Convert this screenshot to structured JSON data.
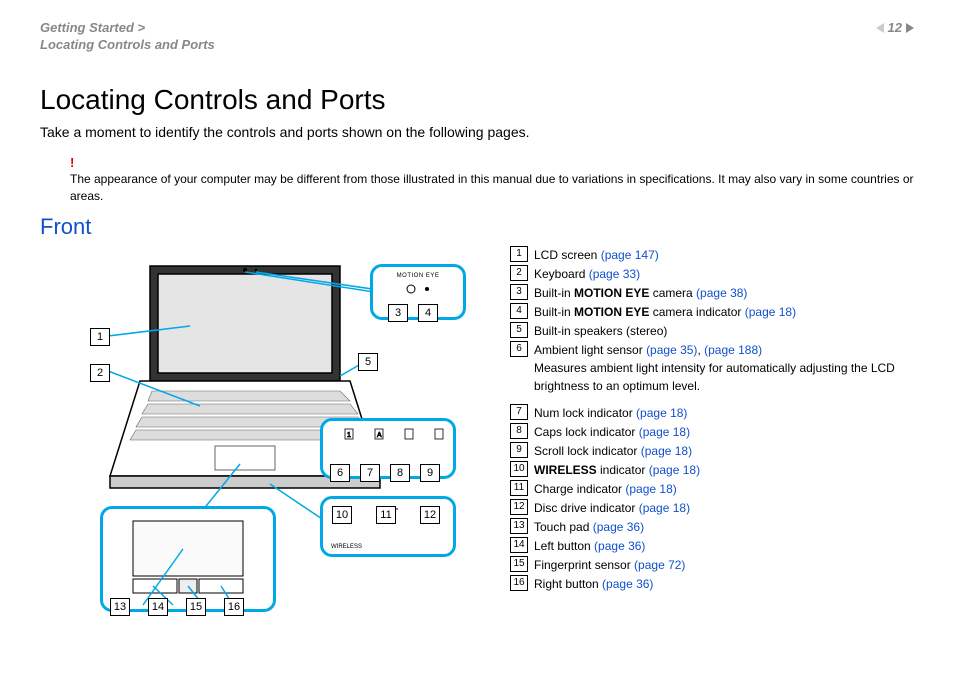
{
  "header": {
    "breadcrumb_line1": "Getting Started >",
    "breadcrumb_line2": "Locating Controls and Ports",
    "page_number": "12"
  },
  "title": "Locating Controls and Ports",
  "intro": "Take a moment to identify the controls and ports shown on the following pages.",
  "note_bang": "!",
  "note_text": "The appearance of your computer may be different from those illustrated in this manual due to variations in specifications. It may also vary in some countries or areas.",
  "section": "Front",
  "inset_labels": {
    "motion_eye": "MOTION EYE",
    "wireless": "WIRELESS"
  },
  "callouts": {
    "c1": "1",
    "c2": "2",
    "c3": "3",
    "c4": "4",
    "c5": "5",
    "c6": "6",
    "c7": "7",
    "c8": "8",
    "c9": "9",
    "c10": "10",
    "c11": "11",
    "c12": "12",
    "c13": "13",
    "c14": "14",
    "c15": "15",
    "c16": "16"
  },
  "legend": [
    {
      "num": "1",
      "pre": "LCD screen ",
      "bold": "",
      "post": "",
      "link": "(page 147)",
      "extra": ""
    },
    {
      "num": "2",
      "pre": "Keyboard ",
      "bold": "",
      "post": "",
      "link": "(page 33)",
      "extra": ""
    },
    {
      "num": "3",
      "pre": "Built-in ",
      "bold": "MOTION EYE",
      "post": " camera ",
      "link": "(page 38)",
      "extra": ""
    },
    {
      "num": "4",
      "pre": "Built-in ",
      "bold": "MOTION EYE",
      "post": " camera indicator ",
      "link": "(page 18)",
      "extra": ""
    },
    {
      "num": "5",
      "pre": "Built-in speakers (stereo)",
      "bold": "",
      "post": "",
      "link": "",
      "extra": ""
    },
    {
      "num": "6",
      "pre": "Ambient light sensor ",
      "bold": "",
      "post": "",
      "link": "(page 35)",
      "link2": ", ",
      "link3": "(page 188)",
      "extra": "Measures ambient light intensity for automatically adjusting the LCD brightness to an optimum level."
    },
    {
      "num": "7",
      "pre": "Num lock indicator ",
      "bold": "",
      "post": "",
      "link": "(page 18)",
      "extra": ""
    },
    {
      "num": "8",
      "pre": "Caps lock indicator ",
      "bold": "",
      "post": "",
      "link": "(page 18)",
      "extra": ""
    },
    {
      "num": "9",
      "pre": "Scroll lock indicator ",
      "bold": "",
      "post": "",
      "link": "(page 18)",
      "extra": ""
    },
    {
      "num": "10",
      "pre": "",
      "bold": "WIRELESS",
      "post": " indicator ",
      "link": "(page 18)",
      "extra": ""
    },
    {
      "num": "11",
      "pre": "Charge indicator ",
      "bold": "",
      "post": "",
      "link": "(page 18)",
      "extra": ""
    },
    {
      "num": "12",
      "pre": "Disc drive indicator ",
      "bold": "",
      "post": "",
      "link": "(page 18)",
      "extra": ""
    },
    {
      "num": "13",
      "pre": "Touch pad ",
      "bold": "",
      "post": "",
      "link": "(page 36)",
      "extra": ""
    },
    {
      "num": "14",
      "pre": "Left button ",
      "bold": "",
      "post": "",
      "link": "(page 36)",
      "extra": ""
    },
    {
      "num": "15",
      "pre": "Fingerprint sensor ",
      "bold": "",
      "post": "",
      "link": "(page 72)",
      "extra": ""
    },
    {
      "num": "16",
      "pre": "Right button ",
      "bold": "",
      "post": "",
      "link": "(page 36)",
      "extra": ""
    }
  ]
}
